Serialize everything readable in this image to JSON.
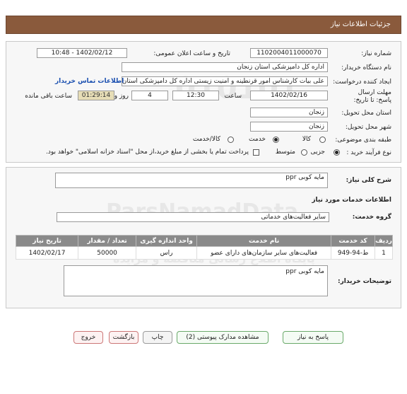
{
  "header": {
    "title": "جزئیات اطلاعات نیاز"
  },
  "form": {
    "need_number": {
      "label": "شماره نیاز:",
      "value": "1102004011000070"
    },
    "announce_datetime": {
      "label": "تاریخ و ساعت اعلان عمومی:",
      "value": "1402/02/12 - 10:48"
    },
    "buyer_org": {
      "label": "نام دستگاه خریدار:",
      "value": "اداره کل دامپزشکی استان زنجان"
    },
    "requester": {
      "label": "ایجاد کننده درخواست:",
      "value": "علی بیات کارشناس امور قرنطینه و امنیت زیستی اداره کل دامپزشکی استان زنجان",
      "contact_link": "اطلاعات تماس خریدار"
    },
    "deadline": {
      "label": "مهلت ارسال پاسخ: تا تاریخ:",
      "date": "1402/02/16",
      "time_label": "ساعت",
      "time": "12:30",
      "days": "4",
      "days_label": "روز و",
      "remaining": "01:29:14",
      "remaining_label": "ساعت باقی مانده"
    },
    "province": {
      "label": "استان محل تحویل:",
      "value": "زنجان"
    },
    "city": {
      "label": "شهر محل تحویل:",
      "value": "زنجان"
    },
    "category": {
      "label": "طبقه بندی موضوعی:",
      "options": [
        "کالا",
        "خدمت",
        "کالا/خدمت"
      ],
      "selected": "خدمت"
    },
    "purchase_type": {
      "label": "نوع فرآیند خرید :",
      "options": [
        "جزیی",
        "متوسط"
      ],
      "selected": "جزیی",
      "note": "پرداخت تمام یا بخشی از مبلغ خرید،از محل \"اسناد خزانه اسلامی\" خواهد بود."
    }
  },
  "need": {
    "summary_label": "شرح کلی نیاز:",
    "summary": "مایه کوبی ppr",
    "services_title": "اطلاعات خدمات مورد نیاز",
    "service_group_label": "گروه خدمت:",
    "service_group": "سایر فعالیت‌های خدماتی",
    "table": {
      "headers": [
        "ردیف",
        "کد خدمت",
        "نام خدمت",
        "واحد اندازه گیری",
        "تعداد / مقدار",
        "تاریخ نیاز"
      ],
      "rows": [
        [
          "1",
          "ط-94-949",
          "فعالیت‌های سایر سازمان‌های دارای عضو",
          "راس",
          "50000",
          "1402/02/17"
        ]
      ]
    },
    "buyer_notes_label": "توضیحات خریدار:",
    "buyer_notes": "مایه کوبی ppr"
  },
  "watermark": {
    "code": "010101",
    "name": "ParsNamadData",
    "line": "پایگاه اطلاع رسانی مناقصه و مزایده",
    "phone": "۰۲۱-۸۸۳۴۹۶۷۰-۵"
  },
  "buttons": {
    "reply": "پاسخ به نیاز",
    "attachments": "مشاهده مدارک پیوستی (2)",
    "print": "چاپ",
    "back": "بازگشت",
    "exit": "خروج"
  }
}
